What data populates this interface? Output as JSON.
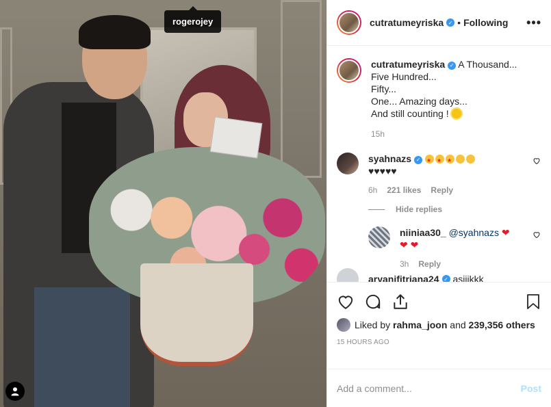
{
  "photo": {
    "tagged_user": "rogerojey"
  },
  "header": {
    "username": "cutratumeyriska",
    "separator": "•",
    "follow_status": "Following",
    "more_label": "•••"
  },
  "caption": {
    "username": "cutratumeyriska",
    "text": "A Thousand...\nFive Hundred...\nFifty...\nOne... Amazing days...\nAnd still counting !",
    "time": "15h"
  },
  "comments": [
    {
      "username": "syahnazs",
      "text": "♥♥♥♥♥",
      "time": "6h",
      "likes": "221 likes",
      "reply_label": "Reply",
      "hide_replies": "Hide replies"
    }
  ],
  "reply": {
    "username": "niiniaa30_",
    "mention": "@syahnazs",
    "time": "3h",
    "reply_label": "Reply"
  },
  "next_comment": {
    "username": "aryanifitriana24",
    "text": "asiiikkk"
  },
  "likes_line": {
    "prefix": "Liked by",
    "user": "rahma_joon",
    "middle": "and",
    "others": "239,356 others"
  },
  "timestamp": "15 HOURS AGO",
  "add_comment": {
    "placeholder": "Add a comment...",
    "post_label": "Post"
  }
}
